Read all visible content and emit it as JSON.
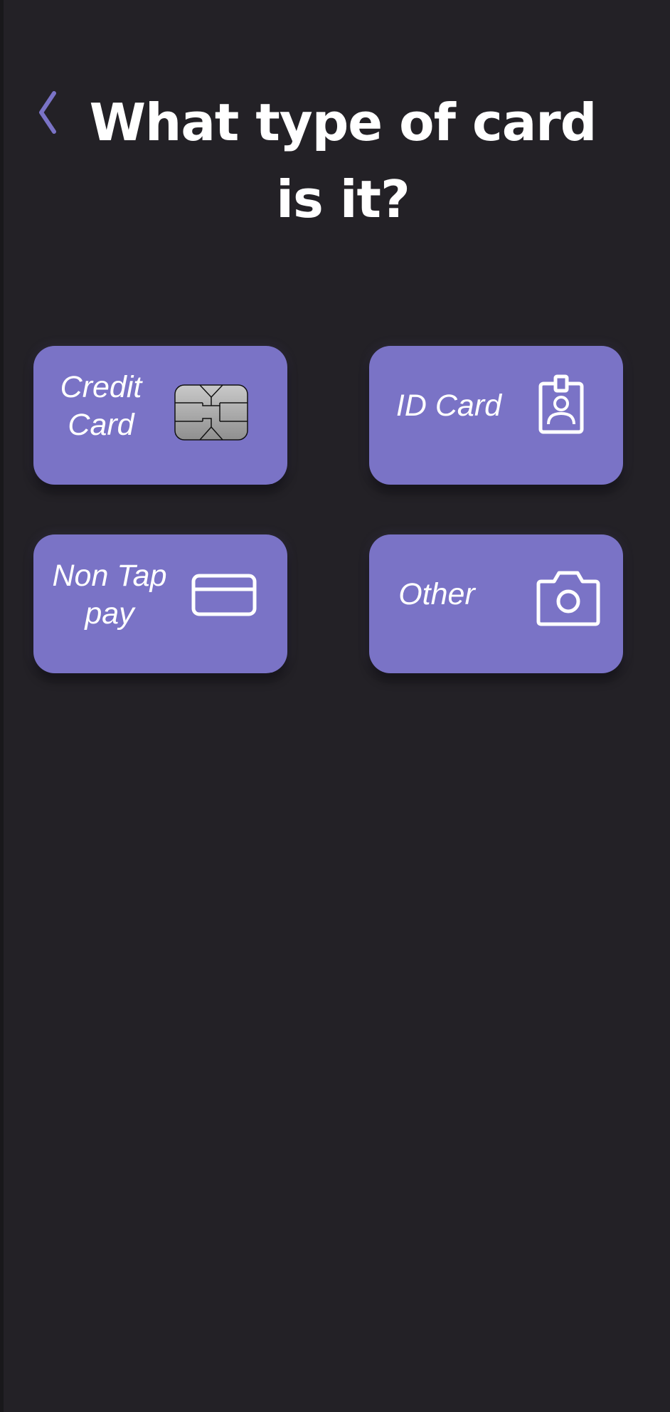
{
  "header": {
    "title": "What type of card is it?",
    "back_icon": "chevron-left-icon",
    "accent_color": "#7a73c6"
  },
  "options": [
    {
      "label_line1": "Credit",
      "label_line2": "Card",
      "icon": "chip-icon"
    },
    {
      "label": "ID Card",
      "icon": "id-badge-icon"
    },
    {
      "label_line1": "Non Tap",
      "label_line2": "pay",
      "icon": "credit-card-icon"
    },
    {
      "label": "Other",
      "icon": "camera-icon"
    }
  ],
  "colors": {
    "background": "#232126",
    "button": "#7a73c6",
    "text": "#ffffff"
  }
}
